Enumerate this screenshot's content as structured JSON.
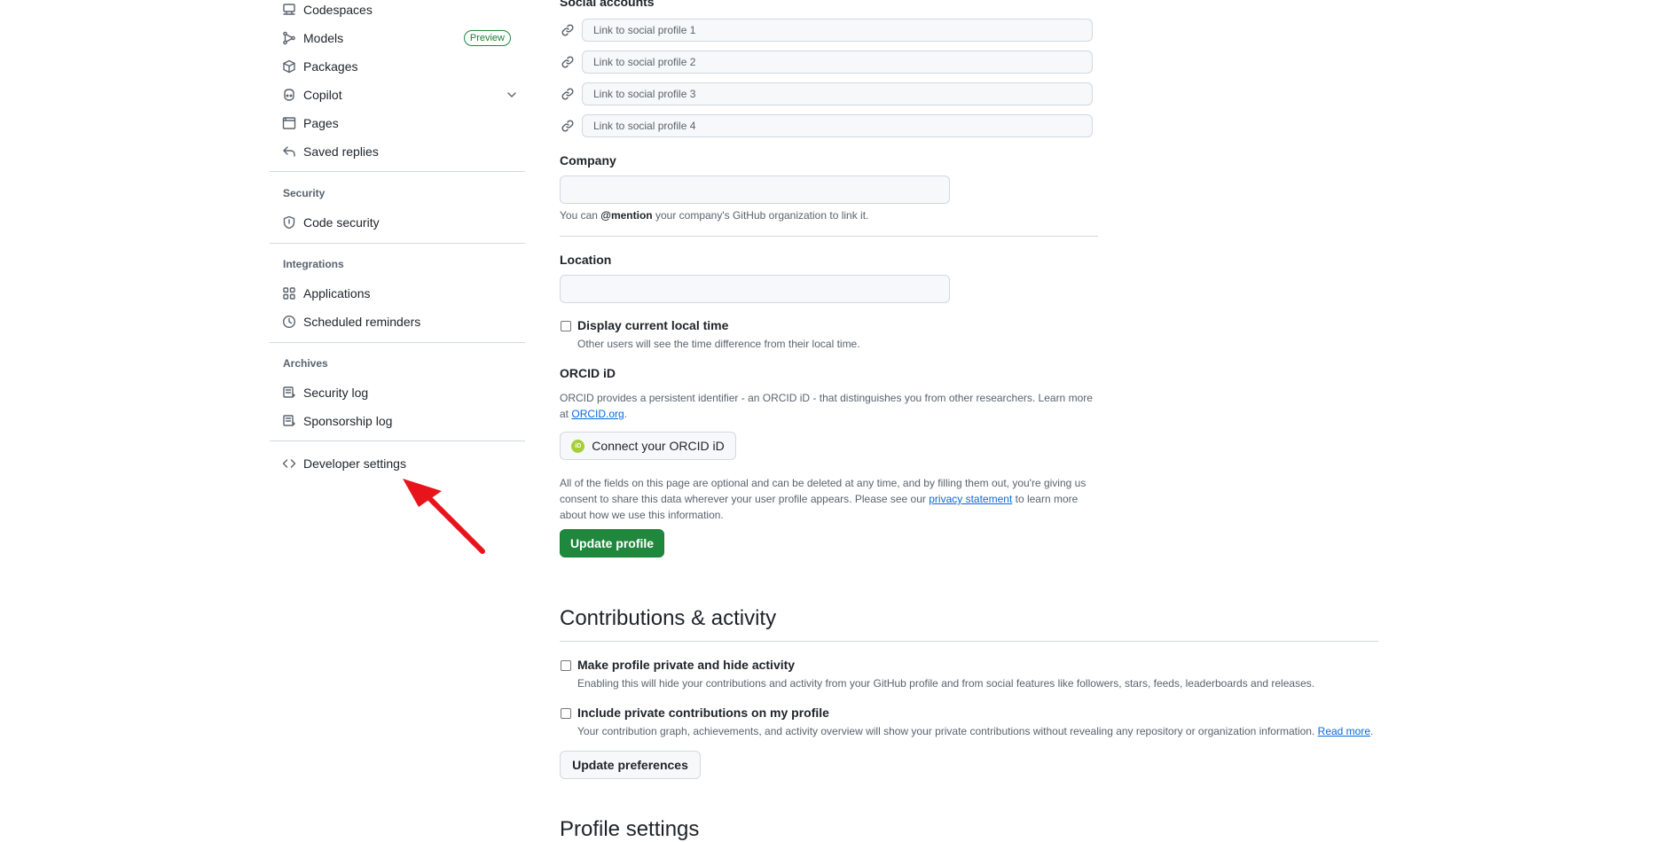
{
  "sidebar": {
    "items_top": [
      {
        "label": "Codespaces",
        "icon": "codespaces-icon"
      },
      {
        "label": "Models",
        "icon": "models-icon",
        "badge": "Preview"
      },
      {
        "label": "Packages",
        "icon": "package-icon"
      },
      {
        "label": "Copilot",
        "icon": "copilot-icon"
      },
      {
        "label": "Pages",
        "icon": "pages-icon"
      },
      {
        "label": "Saved replies",
        "icon": "reply-icon"
      }
    ],
    "security": {
      "heading": "Security",
      "items": [
        {
          "label": "Code security",
          "icon": "shield-icon"
        }
      ]
    },
    "integrations": {
      "heading": "Integrations",
      "items": [
        {
          "label": "Applications",
          "icon": "apps-icon"
        },
        {
          "label": "Scheduled reminders",
          "icon": "clock-icon"
        }
      ]
    },
    "archives": {
      "heading": "Archives",
      "items": [
        {
          "label": "Security log",
          "icon": "log-icon"
        },
        {
          "label": "Sponsorship log",
          "icon": "log-icon"
        }
      ]
    },
    "developer": {
      "label": "Developer settings",
      "icon": "code-icon"
    }
  },
  "social": {
    "heading": "Social accounts",
    "placeholders": [
      "Link to social profile 1",
      "Link to social profile 2",
      "Link to social profile 3",
      "Link to social profile 4"
    ]
  },
  "company": {
    "label": "Company",
    "hint_pre": "You can ",
    "hint_mention": "@mention",
    "hint_post": " your company's GitHub organization to link it."
  },
  "location": {
    "label": "Location",
    "local_time_label": "Display current local time",
    "local_time_hint": "Other users will see the time difference from their local time."
  },
  "orcid": {
    "heading": "ORCID iD",
    "desc": "ORCID provides a persistent identifier - an ORCID iD - that distinguishes you from other researchers. Learn more at",
    "link": "ORCID.org",
    "link_suffix": ".",
    "button": "Connect your ORCID iD"
  },
  "disclaimer": {
    "pre": "All of the fields on this page are optional and can be deleted at any time, and by filling them out, you're giving us consent to share this data wherever your user profile appears. Please see our ",
    "link": "privacy statement",
    "post": " to learn more about how we use this information."
  },
  "update_profile": "Update profile",
  "contributions": {
    "heading": "Contributions & activity",
    "private_label": "Make profile private and hide activity",
    "private_hint": "Enabling this will hide your contributions and activity from your GitHub profile and from social features like followers, stars, feeds, leaderboards and releases.",
    "include_label": "Include private contributions on my profile",
    "include_hint": "Your contribution graph, achievements, and activity overview will show your private contributions without revealing any repository or organization information. ",
    "include_link": "Read more",
    "include_link_suffix": ".",
    "button": "Update preferences"
  },
  "next_heading": "Profile settings",
  "colors": {
    "primary": "#1f883d",
    "link": "#0969da",
    "annotation": "#e8141c"
  }
}
